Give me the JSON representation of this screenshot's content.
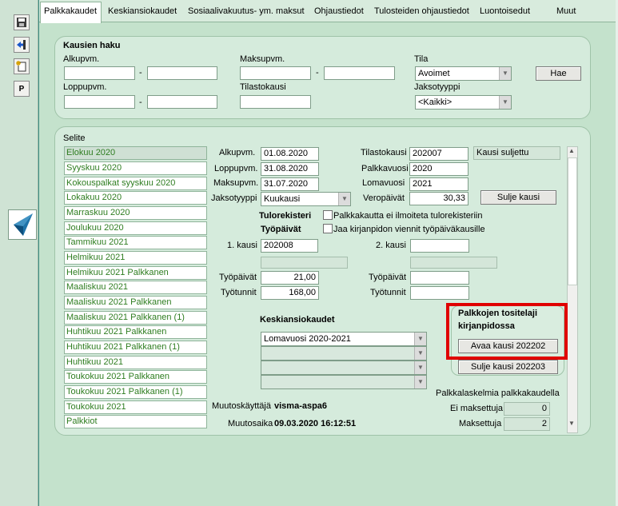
{
  "toolbar": {
    "print_label": "P"
  },
  "tabs": [
    {
      "label": "Palkkakaudet"
    },
    {
      "label": "Keskiansiokaudet"
    },
    {
      "label": "Sosiaalivakuutus- ym. maksut"
    },
    {
      "label": "Ohjaustiedot"
    },
    {
      "label": "Tulosteiden ohjaustiedot"
    },
    {
      "label": "Luontoisedut"
    },
    {
      "label": "Muut"
    }
  ],
  "search": {
    "title": "Kausien haku",
    "alkupvm_label": "Alkupvm.",
    "loppupvm_label": "Loppupvm.",
    "maksupvm_label": "Maksupvm.",
    "tilastokausi_label": "Tilastokausi",
    "tila_label": "Tila",
    "tila_value": "Avoimet",
    "jaksotyyppi_label": "Jaksotyyppi",
    "jaksotyyppi_value": "<Kaikki>",
    "dash": "-",
    "hae_label": "Hae"
  },
  "detail": {
    "selite_label": "Selite",
    "periods": [
      "Elokuu 2020",
      "Syyskuu 2020",
      "Kokouspalkat syyskuu 2020",
      "Lokakuu 2020",
      "Marraskuu 2020",
      "Joulukuu 2020",
      "Tammikuu 2021",
      "Helmikuu 2021",
      "Helmikuu 2021 Palkkanen",
      "Maaliskuu 2021",
      "Maaliskuu 2021 Palkkanen",
      "Maaliskuu 2021 Palkkanen (1)",
      "Huhtikuu 2021 Palkkanen",
      "Huhtikuu 2021 Palkkanen (1)",
      "Huhtikuu 2021",
      "Toukokuu 2021 Palkkanen",
      "Toukokuu 2021 Palkkanen (1)",
      "Toukokuu 2021",
      "Palkkiot"
    ],
    "alkupvm_label": "Alkupvm.",
    "alkupvm": "01.08.2020",
    "loppupvm_label": "Loppupvm.",
    "loppupvm": "31.08.2020",
    "maksupvm_label": "Maksupvm.",
    "maksupvm": "31.07.2020",
    "jaksotyyppi_label": "Jaksotyyppi",
    "jaksotyyppi": "Kuukausi",
    "tilastokausi_label": "Tilastokausi",
    "tilastokausi": "202007",
    "palkkavuosi_label": "Palkkavuosi",
    "palkkavuosi": "2020",
    "lomavuosi_label": "Lomavuosi",
    "lomavuosi": "2021",
    "veropaivat_label": "Veropäivät",
    "veropaivat": "30,33",
    "status": "Kausi suljettu",
    "sulje_kausi_label": "Sulje kausi",
    "tulorekisteri_label": "Tulorekisteri",
    "tulorekisteri_check": "Palkkakautta ei ilmoiteta tulorekisteriin",
    "tyopaivat_heading": "Työpäivät",
    "jaa_check": "Jaa kirjanpidon viennit työpäiväkausille",
    "kausi1_label": "1. kausi",
    "kausi1": "202008",
    "kausi2_label": "2. kausi",
    "tyopaivat_label": "Työpäivät",
    "tyopaivat": "21,00",
    "tyotunnit_label": "Työtunnit",
    "tyotunnit": "168,00",
    "tyopaivat2_label": "Työpäivät",
    "tyotunnit2_label": "Työtunnit",
    "keskiansiokaudet_label": "Keskiansiokaudet",
    "keskiansio1": "Lomavuosi 2020-2021",
    "tositelaji_title_1": "Palkkojen tositelaji",
    "tositelaji_title_2": "kirjanpidossa",
    "avaa_kausi_label": "Avaa kausi 202202",
    "sulje_kausi2_label": "Sulje kausi 202203",
    "palkkalaskelmia_label": "Palkkalaskelmia palkkakaudella",
    "ei_maksettuja_label": "Ei maksettuja",
    "ei_maksettuja": "0",
    "maksettuja_label": "Maksettuja",
    "maksettuja": "2",
    "muutoskayttaja_label": "Muutoskäyttäjä",
    "muutoskayttaja": "visma-aspa6",
    "muutosaika_label": "Muutosaika",
    "muutosaika": "09.03.2020 16:12:51"
  },
  "colors": {
    "accent_green_text": "#2e7d20",
    "highlight_red": "#e00000",
    "panel_bg": "#d5ebdc"
  }
}
